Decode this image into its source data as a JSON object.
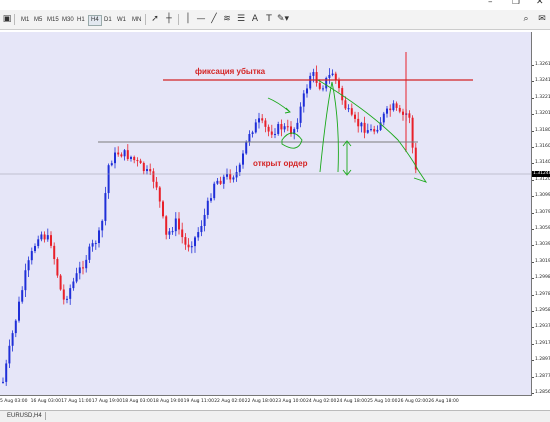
{
  "window": {
    "minimize": "–",
    "restore": "❐",
    "close": "✕"
  },
  "toolbar": {
    "timeframes": [
      {
        "label": "M1",
        "active": false
      },
      {
        "label": "M5",
        "active": false
      },
      {
        "label": "M15",
        "active": false
      },
      {
        "label": "M30",
        "active": false
      },
      {
        "label": "H1",
        "active": false
      },
      {
        "label": "H4",
        "active": true
      },
      {
        "label": "D1",
        "active": false
      },
      {
        "label": "W1",
        "active": false
      },
      {
        "label": "MN",
        "active": false
      }
    ],
    "tools": [
      "cursor-icon",
      "crosshair-icon",
      "vertical-line-icon",
      "horizontal-line-icon",
      "trendline-icon",
      "fibonacci-icon",
      "channel-icon",
      "text-icon",
      "text-label-icon",
      "shapes-icon"
    ],
    "text_tool": "A",
    "label_tool": "T"
  },
  "chart": {
    "symbol_tab": "EURUSD,H4",
    "current_price": "1.31248",
    "price_labels": [
      "1.32615",
      "1.32415",
      "1.32210",
      "1.32010",
      "1.31805",
      "1.31600",
      "1.31400",
      "1.31200",
      "1.30996",
      "1.30795",
      "1.30590",
      "1.30390",
      "1.30195",
      "1.29985",
      "1.29780",
      "1.29580",
      "1.29375",
      "1.29175",
      "1.28970",
      "1.28770",
      "1.28565"
    ],
    "time_labels": [
      "5 Aug 03:00",
      "16 Aug 03:00",
      "17 Aug 11:00",
      "17 Aug 19:00",
      "18 Aug 03:00",
      "18 Aug 19:00",
      "19 Aug 11:00",
      "22 Aug 02:00",
      "22 Aug 18:00",
      "23 Aug 10:00",
      "24 Aug 02:00",
      "24 Aug 18:00",
      "25 Aug 10:00",
      "26 Aug 02:00",
      "26 Aug 18:00"
    ],
    "annotations": {
      "stop_loss": "фиксация убытка",
      "order_open": "открыт ордер"
    },
    "colors": {
      "bull": "#1f2fd8",
      "bear": "#e8202a",
      "background": "#e6e6f8",
      "annotation": "#d42424",
      "drawing": "#1aa81a"
    }
  }
}
